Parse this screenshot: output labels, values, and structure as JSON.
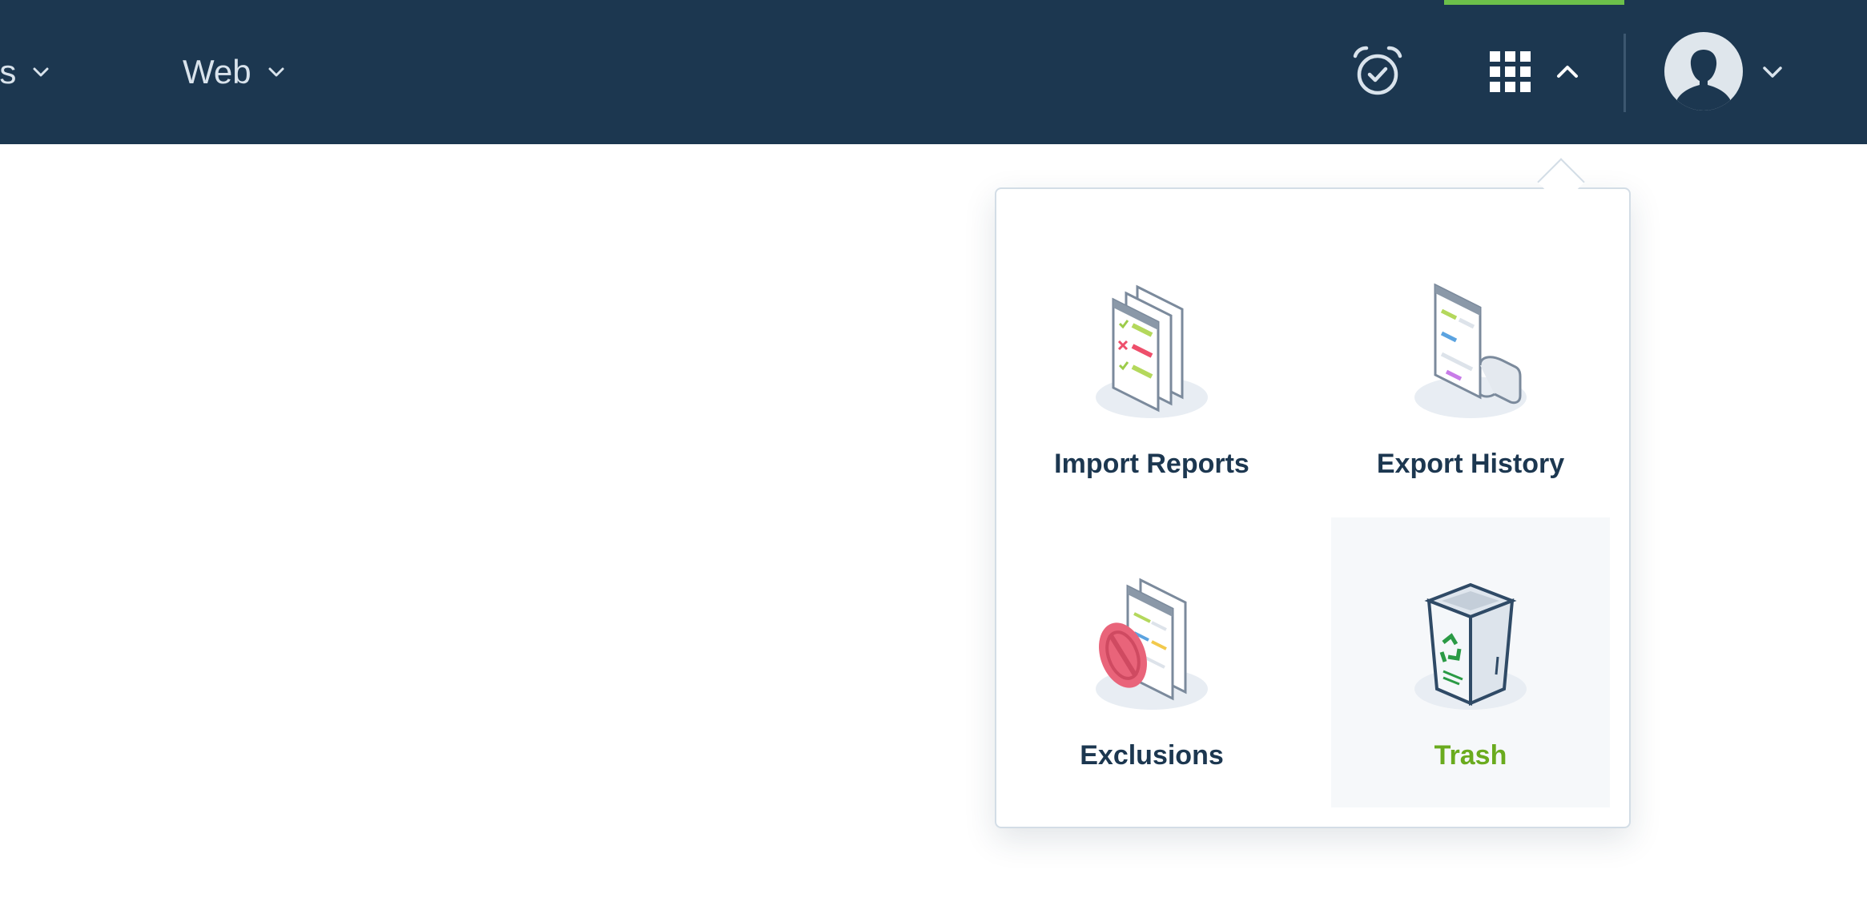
{
  "nav": {
    "partial_label": "ls",
    "web_label": "Web"
  },
  "header_icons": [
    "alarm-check-icon",
    "grid-menu-icon",
    "chevron-up-icon",
    "avatar",
    "chevron-down-icon"
  ],
  "colors": {
    "topbar": "#1c3750",
    "active_indicator": "#6cc04a",
    "text_dark": "#1c3750",
    "accent_green": "#6aab1e"
  },
  "menu": {
    "items": [
      {
        "label": "Import Reports",
        "icon": "import-reports-icon"
      },
      {
        "label": "Export History",
        "icon": "export-history-icon"
      },
      {
        "label": "Exclusions",
        "icon": "exclusions-icon"
      },
      {
        "label": "Trash",
        "icon": "trash-icon",
        "hovered": true
      }
    ]
  }
}
